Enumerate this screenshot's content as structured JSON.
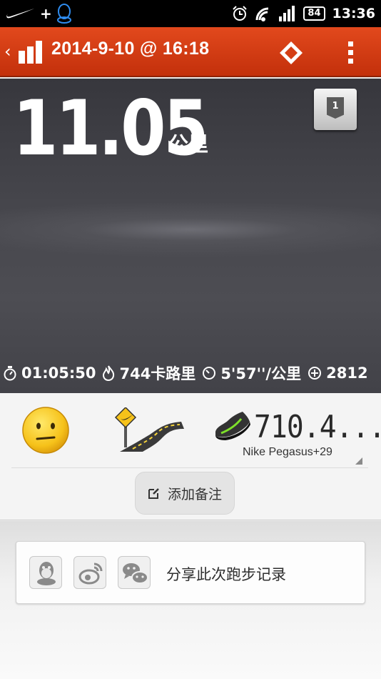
{
  "status_bar": {
    "battery": "84",
    "time": "13:36"
  },
  "header": {
    "title": "2014-9-10 @ 16:18"
  },
  "run": {
    "distance": "11.05",
    "distance_unit": "公里",
    "rank": "1",
    "duration": "01:05:50",
    "calories": "744卡路里",
    "pace": "5'57''/公里",
    "fuel": "2812"
  },
  "gear": {
    "shoe_distance": "710.4...",
    "shoe_name": "Nike Pegasus+29"
  },
  "actions": {
    "add_note": "添加备注",
    "share_label": "分享此次跑步记录"
  },
  "colors": {
    "header": "#d43e14",
    "hero_bg": "#45454b"
  }
}
